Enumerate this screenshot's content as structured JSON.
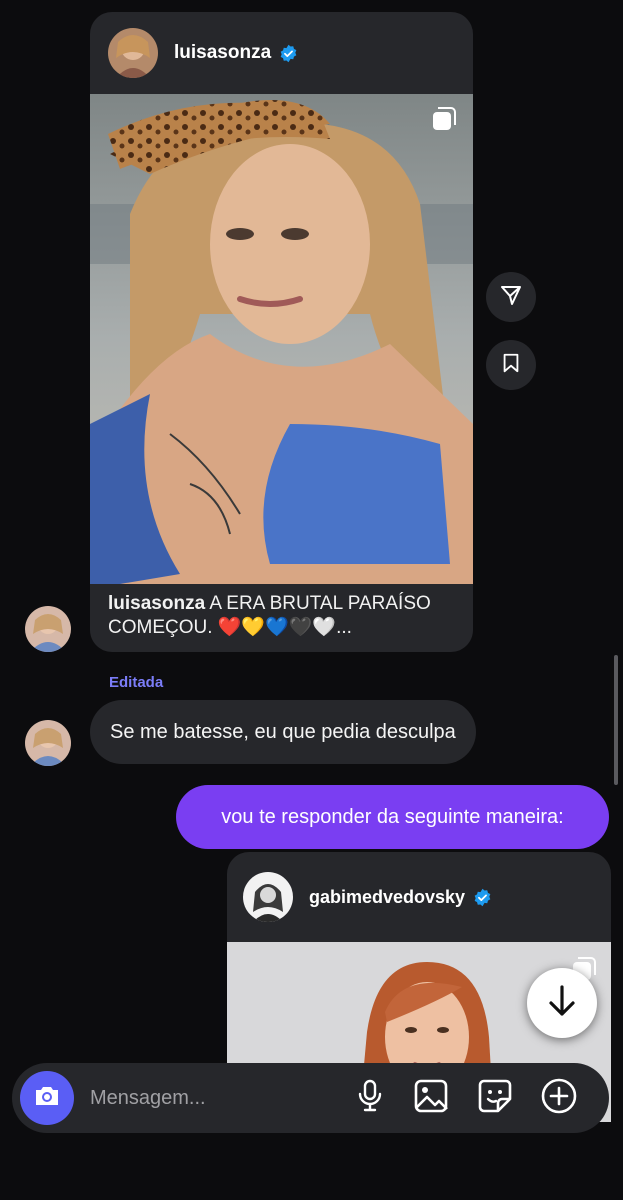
{
  "colors": {
    "background": "#0c0c0e",
    "bubble_incoming": "#26272b",
    "bubble_outgoing": "#7a3ef2",
    "accent": "#5a5ef5",
    "edited_label": "#7b7df8",
    "verified": "#1d9bf0"
  },
  "posts": [
    {
      "username": "luisasonza",
      "verified": true,
      "multi_image_icon": "multi-image-icon",
      "caption_username": "luisasonza",
      "caption_text": " A ERA BRUTAL PARAÍSO COMEÇOU. ❤️💛💙🖤🤍..."
    },
    {
      "username": "gabimedvedovsky",
      "verified": true,
      "multi_image_icon": "multi-image-icon"
    }
  ],
  "side_actions": [
    "share-icon",
    "bookmark-icon"
  ],
  "messages": {
    "edited_label": "Editada",
    "incoming_text": "Se me batesse, eu que pedia desculpa",
    "outgoing_text": "vou te responder da seguinte maneira:"
  },
  "composer": {
    "placeholder": "Mensagem...",
    "icons": [
      "camera-icon",
      "microphone-icon",
      "gallery-icon",
      "sticker-icon",
      "plus-icon"
    ]
  },
  "scroll_down_icon": "arrow-down-icon"
}
